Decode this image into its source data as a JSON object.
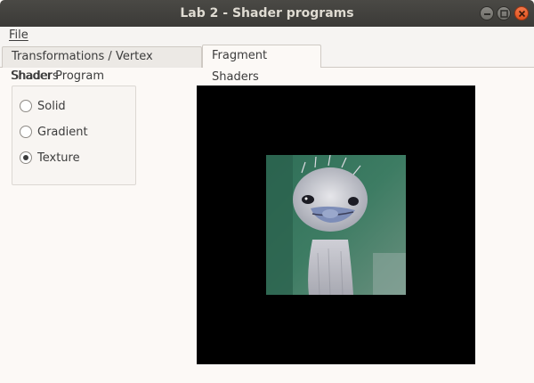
{
  "window": {
    "title": "Lab 2 - Shader programs"
  },
  "menubar": {
    "file_label": "File"
  },
  "tabs": [
    {
      "label": "Transformations / Vertex Shaders",
      "active": false
    },
    {
      "label": "Fragment Shaders",
      "active": true
    }
  ],
  "shader_program": {
    "group_label": "Shader Program",
    "options": [
      {
        "label": "Solid",
        "checked": false
      },
      {
        "label": "Gradient",
        "checked": false
      },
      {
        "label": "Texture",
        "checked": true
      }
    ]
  },
  "viewport": {
    "background_color": "#000000",
    "texture_subject": "ostrich-head photo"
  },
  "colors": {
    "titlebar_bg": "#3b3a37",
    "close_button": "#e0521e",
    "window_bg": "#fcf9f6"
  }
}
